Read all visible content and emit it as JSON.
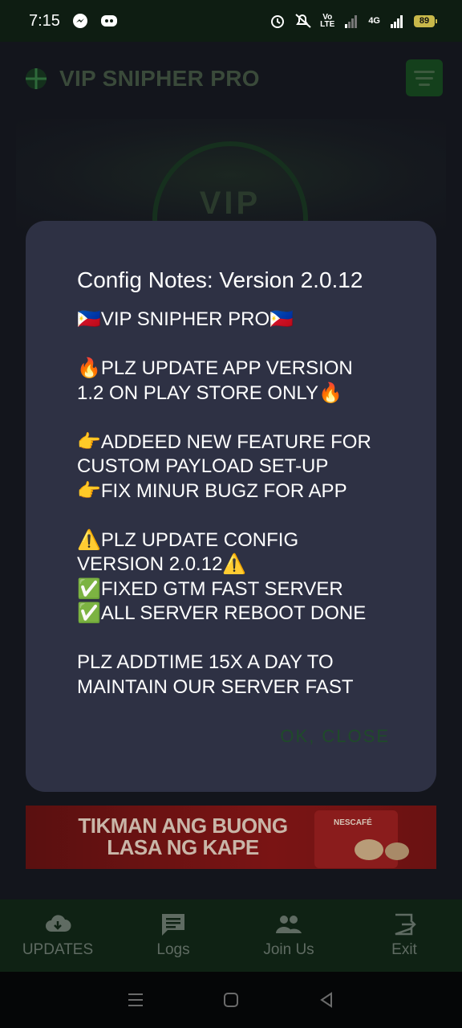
{
  "status_bar": {
    "time": "7:15",
    "battery": "89",
    "lte_label": "Vo\nLTE",
    "network_label": "4G"
  },
  "app": {
    "title": "VIP SNIPHER PRO",
    "hero_text": "VIP"
  },
  "dialog": {
    "title": "Config Notes: Version 2.0.12",
    "body": "🇵🇭VIP SNIPHER PRO🇵🇭\n\n🔥PLZ UPDATE APP VERSION\n1.2 ON PLAY STORE ONLY🔥\n\n👉ADDEED NEW FEATURE FOR\nCUSTOM PAYLOAD SET-UP\n👉FIX MINUR BUGZ FOR APP\n\n⚠️PLZ UPDATE CONFIG\nVERSION 2.0.12⚠️\n✅FIXED GTM FAST SERVER\n✅ALL SERVER REBOOT DONE\n\nPLZ ADDTIME 15X A DAY TO\nMAINTAIN OUR SERVER FAST",
    "ok_label": "OK, CLOSE"
  },
  "ad": {
    "text": "TIKMAN ANG BUONG\nLASA NG KAPE",
    "brand": "NESCAFÉ"
  },
  "bottom_nav": {
    "items": [
      {
        "label": "UPDATES",
        "icon": "cloud-download-icon"
      },
      {
        "label": "Logs",
        "icon": "message-icon"
      },
      {
        "label": "Join Us",
        "icon": "group-icon"
      },
      {
        "label": "Exit",
        "icon": "exit-icon"
      }
    ]
  },
  "system_nav": {
    "icons": [
      "recents-icon",
      "home-icon",
      "back-icon"
    ]
  }
}
